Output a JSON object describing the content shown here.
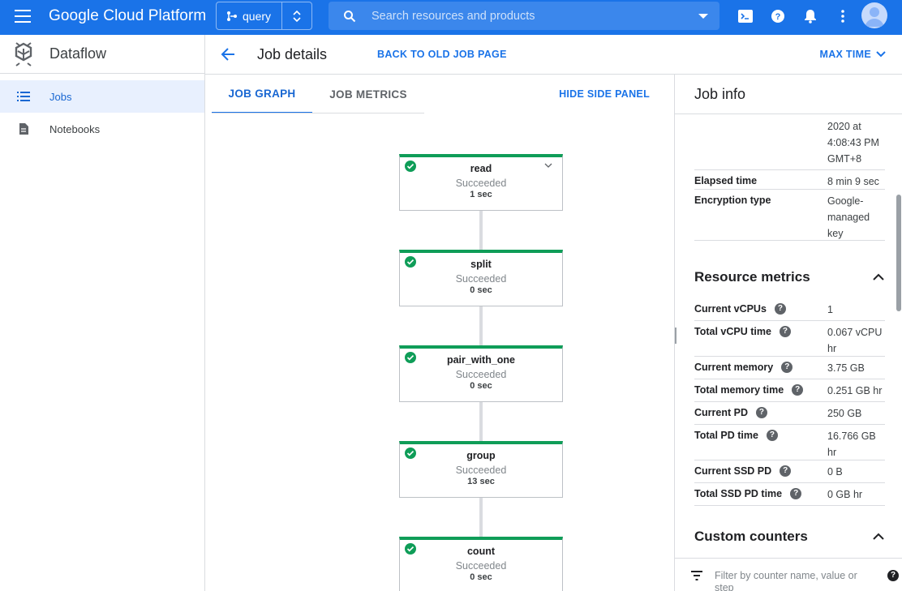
{
  "topbar": {
    "brand": "Google Cloud Platform",
    "project": "query",
    "search_placeholder": "Search resources and products"
  },
  "sidebar": {
    "product": "Dataflow",
    "items": [
      {
        "label": "Jobs",
        "active": true
      },
      {
        "label": "Notebooks",
        "active": false
      }
    ]
  },
  "header": {
    "title": "Job details",
    "old_link": "BACK TO OLD JOB PAGE",
    "max_time": "MAX TIME"
  },
  "tabs": {
    "graph": "JOB GRAPH",
    "metrics": "JOB METRICS",
    "hide_panel": "HIDE SIDE PANEL"
  },
  "graph": {
    "nodes": [
      {
        "name": "read",
        "status": "Succeeded",
        "time": "1 sec"
      },
      {
        "name": "split",
        "status": "Succeeded",
        "time": "0 sec"
      },
      {
        "name": "pair_with_one",
        "status": "Succeeded",
        "time": "0 sec"
      },
      {
        "name": "group",
        "status": "Succeeded",
        "time": "13 sec"
      },
      {
        "name": "count",
        "status": "Succeeded",
        "time": "0 sec"
      }
    ]
  },
  "panel": {
    "title": "Job info",
    "info": {
      "partial_date": "2020 at 4:08:43 PM GMT+8",
      "elapsed_label": "Elapsed time",
      "elapsed_value": "8 min 9 sec",
      "encryption_label": "Encryption type",
      "encryption_value": "Google-managed key"
    },
    "resource_title": "Resource metrics",
    "metrics": [
      {
        "label": "Current vCPUs",
        "value": "1"
      },
      {
        "label": "Total vCPU time",
        "value": "0.067 vCPU hr"
      },
      {
        "label": "Current memory",
        "value": "3.75 GB"
      },
      {
        "label": "Total memory time",
        "value": "0.251 GB hr"
      },
      {
        "label": "Current PD",
        "value": "250 GB"
      },
      {
        "label": "Total PD time",
        "value": "16.766 GB hr"
      },
      {
        "label": "Current SSD PD",
        "value": "0 B"
      },
      {
        "label": "Total SSD PD time",
        "value": "0 GB hr"
      }
    ],
    "counters_title": "Custom counters",
    "filter_placeholder": "Filter by counter name, value or step"
  },
  "colors": {
    "primary": "#1a73e8",
    "success": "#0f9d58"
  }
}
